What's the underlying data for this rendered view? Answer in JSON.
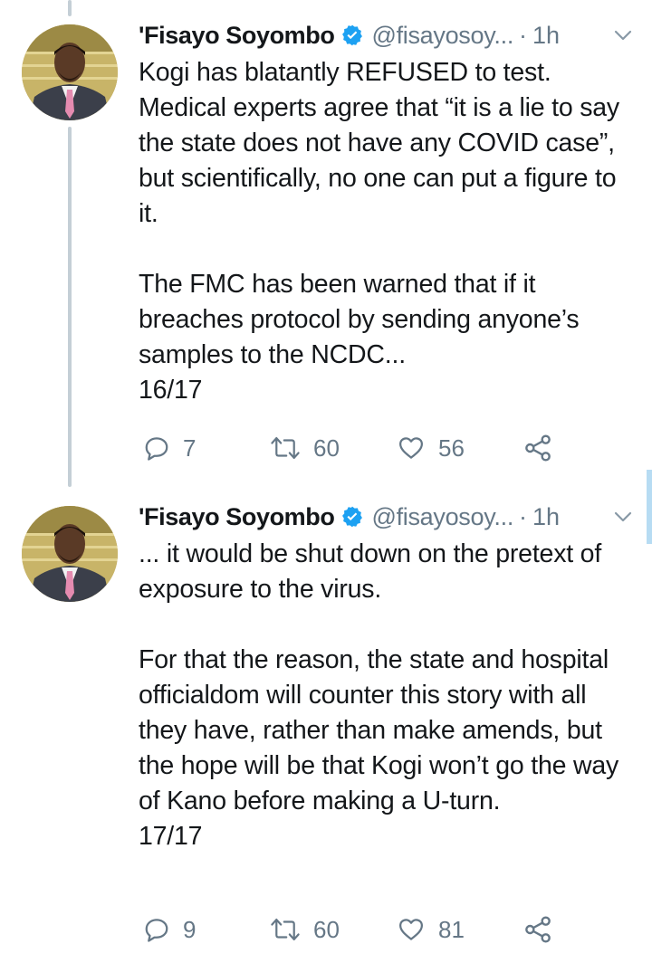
{
  "tweets": [
    {
      "author_name": "'Fisayo Soyombo",
      "handle": "@fisayosoy...",
      "separator": "·",
      "time": "1h",
      "paragraphs": [
        "Kogi has blatantly REFUSED to test. Medical experts agree that “it is a lie to say the state does not have any COVID case”, but scientifically, no one can put a figure to it.",
        "The FMC has been warned that if it breaches protocol by sending anyone’s samples to the NCDC...\n16/17"
      ],
      "replies": "7",
      "retweets": "60",
      "likes": "56"
    },
    {
      "author_name": "'Fisayo Soyombo",
      "handle": "@fisayosoy...",
      "separator": "·",
      "time": "1h",
      "paragraphs": [
        "... it would be shut down on the pretext of exposure to the virus.",
        "For that the reason, the state and hospital officialdom will counter this story with all they have, rather than make amends, but the hope will be that Kogi won’t go the way of Kano before making a U-turn.\n17/17"
      ],
      "replies": "9",
      "retweets": "60",
      "likes": "81"
    }
  ],
  "icons": {
    "verified": "verified-badge-icon",
    "more": "chevron-down-icon",
    "reply": "reply-icon",
    "retweet": "retweet-icon",
    "like": "heart-icon",
    "share": "share-icon"
  },
  "colors": {
    "text": "#14171a",
    "secondary": "#657786",
    "verified": "#1da1f2",
    "thread_line": "#c4cfd6"
  }
}
